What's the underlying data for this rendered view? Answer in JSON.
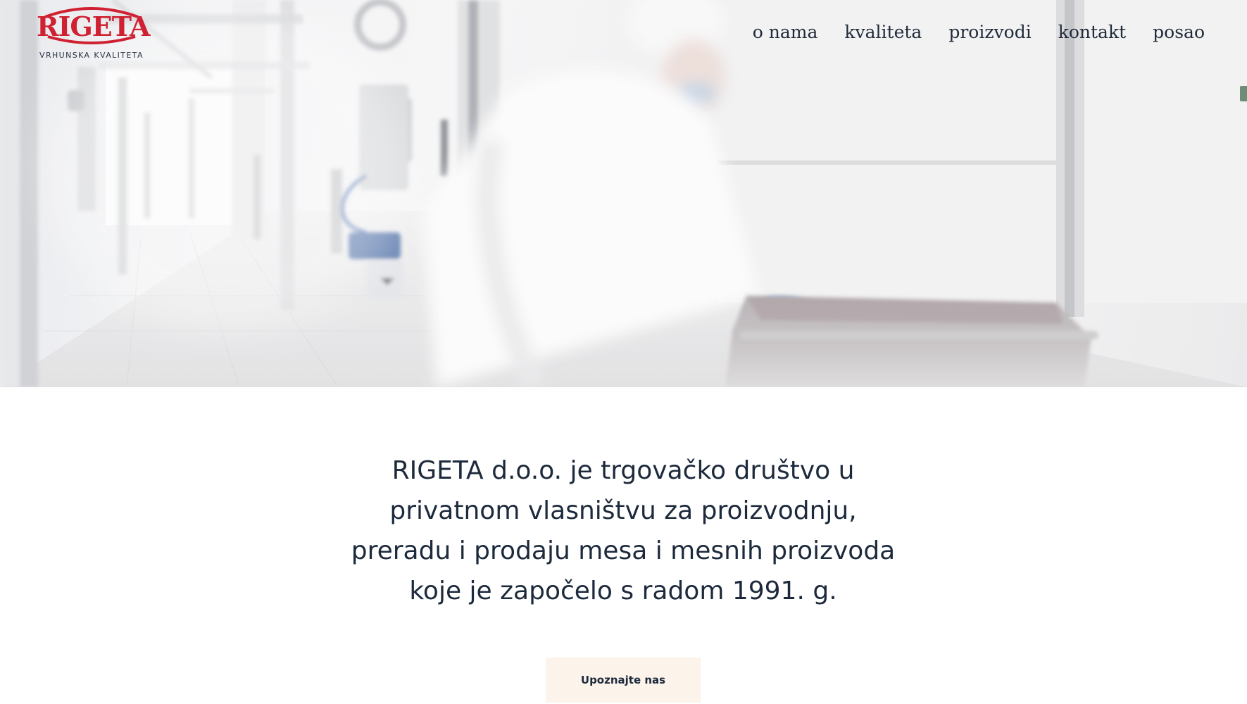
{
  "brand": {
    "name": "RIGETA",
    "tagline": "VRHUNSKA KVALITETA",
    "red": "#cf2131",
    "navy": "#1f2a3a"
  },
  "nav": {
    "items": [
      "o nama",
      "kvaliteta",
      "proizvodi",
      "kontakt",
      "posao"
    ]
  },
  "intro": {
    "lines": [
      "RIGETA d.o.o. je trgovačko društvo u",
      "privatnom vlasništvu za proizvodnju,",
      "preradu i prodaju mesa i mesnih proizvoda",
      "koje je započelo s radom 1991. g."
    ]
  },
  "cta": {
    "label": "Upoznajte nas",
    "background": "#fcf3ea"
  }
}
